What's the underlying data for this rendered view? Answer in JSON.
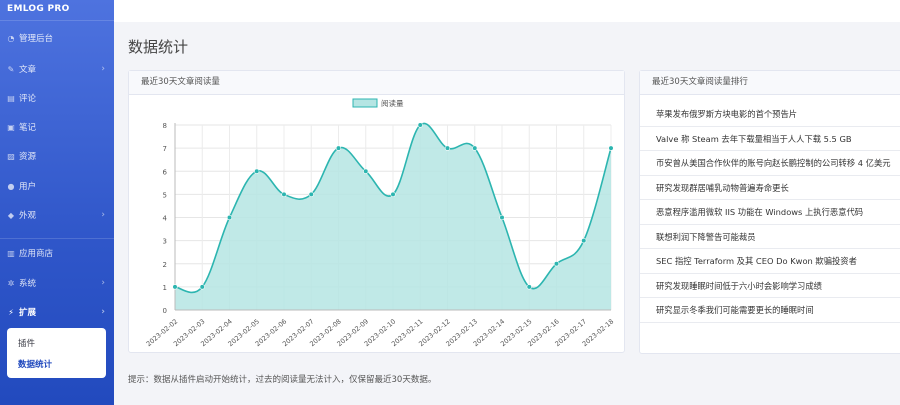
{
  "brand": "EMLOG PRO",
  "sidebar": {
    "items": [
      {
        "label": "管理后台",
        "icon": "dashboard-icon",
        "glyph": "◔",
        "chevron": false
      },
      {
        "label": "文章",
        "icon": "pencil-icon",
        "glyph": "✎",
        "chevron": true
      },
      {
        "label": "评论",
        "icon": "comment-icon",
        "glyph": "▤",
        "chevron": false
      },
      {
        "label": "笔记",
        "icon": "note-icon",
        "glyph": "▣",
        "chevron": false
      },
      {
        "label": "资源",
        "icon": "image-icon",
        "glyph": "▨",
        "chevron": false
      },
      {
        "label": "用户",
        "icon": "user-icon",
        "glyph": "●",
        "chevron": false
      },
      {
        "label": "外观",
        "icon": "brush-icon",
        "glyph": "◆",
        "chevron": true
      },
      {
        "label": "应用商店",
        "icon": "store-icon",
        "glyph": "▥",
        "chevron": false
      },
      {
        "label": "系统",
        "icon": "gear-icon",
        "glyph": "✲",
        "chevron": true
      },
      {
        "label": "扩展",
        "icon": "plug-icon",
        "glyph": "⚡",
        "chevron": true
      }
    ],
    "submenu": [
      {
        "label": "插件"
      },
      {
        "label": "数据统计"
      }
    ]
  },
  "page_title": "数据统计",
  "chart_card": {
    "title": "最近30天文章阅读量"
  },
  "rank_card": {
    "title": "最近30天文章阅读量排行",
    "items": [
      "苹果发布俄罗斯方块电影的首个预告片",
      "Valve 称 Steam 去年下载量相当于人人下载 5.5 GB",
      "币安曾从美国合作伙伴的账号向赵长鹏控制的公司转移 4 亿美元",
      "研究发现群居哺乳动物普遍寿命更长",
      "恶意程序滥用微软 IIS 功能在 Windows 上执行恶意代码",
      "联想利润下降警告可能裁员",
      "SEC 指控 Terraform 及其 CEO Do Kwon 欺骗投资者",
      "研究发现睡眠时间低于六小时会影响学习成绩",
      "研究显示冬季我们可能需要更长的睡眠时间"
    ]
  },
  "hint": "提示：数据从插件启动开始统计，过去的阅读量无法计入，仅保留最近30天数据。",
  "colors": {
    "line": "#2cb5b0",
    "fill": "#b5e5e3",
    "accent": "#224abe"
  },
  "chart_data": {
    "type": "area",
    "legend": "阅读量",
    "legend_position": "top-center",
    "x": [
      "2023-02-02",
      "2023-02-03",
      "2023-02-04",
      "2023-02-05",
      "2023-02-06",
      "2023-02-07",
      "2023-02-08",
      "2023-02-09",
      "2023-02-10",
      "2023-02-11",
      "2023-02-12",
      "2023-02-13",
      "2023-02-14",
      "2023-02-15",
      "2023-02-16",
      "2023-02-17",
      "2023-02-18"
    ],
    "series": [
      {
        "name": "阅读量",
        "values": [
          1,
          1,
          4,
          6,
          5,
          5,
          7,
          6,
          5,
          8,
          7,
          7,
          4,
          1,
          2,
          3,
          7
        ]
      }
    ],
    "yticks": [
      0,
      1,
      2,
      3,
      4,
      5,
      6,
      7,
      8
    ],
    "ylim": [
      0,
      8
    ],
    "grid": true
  }
}
